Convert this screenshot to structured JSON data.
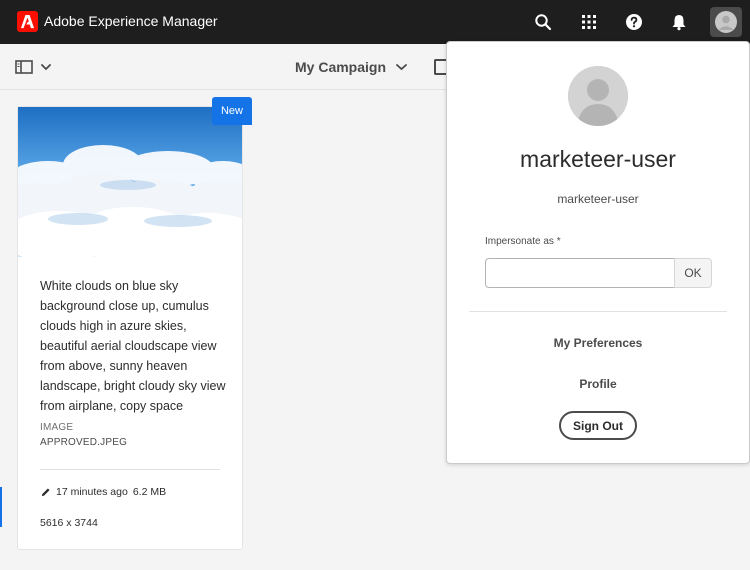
{
  "app": {
    "title": "Adobe Experience Manager"
  },
  "topbar": {
    "icons": [
      "adobe-logo",
      "search-icon",
      "apps-grid-icon",
      "help-icon",
      "bell-icon",
      "user-avatar-icon"
    ]
  },
  "actionbar": {
    "campaign": "My Campaign"
  },
  "card": {
    "badge": "New",
    "title": "White clouds on blue sky background close up, cumulus clouds high in azure skies, beautiful aerial cloudscape view from above, sunny heaven landscape, bright cloudy sky view from airplane, copy space",
    "type": "IMAGE",
    "filename": "APPROVED.JPEG",
    "modified": "17 minutes ago",
    "size": "6.2 MB",
    "dimensions": "5616 x 3744"
  },
  "user_menu": {
    "display_name": "marketeer-user",
    "username": "marketeer-user",
    "impersonate_label": "Impersonate as *",
    "impersonate_value": "",
    "ok_label": "OK",
    "preferences_label": "My Preferences",
    "profile_label": "Profile",
    "sign_out_label": "Sign Out"
  },
  "colors": {
    "topbar": "#1e1e1e",
    "accent": "#1473e6",
    "brand": "#fa0f00"
  }
}
